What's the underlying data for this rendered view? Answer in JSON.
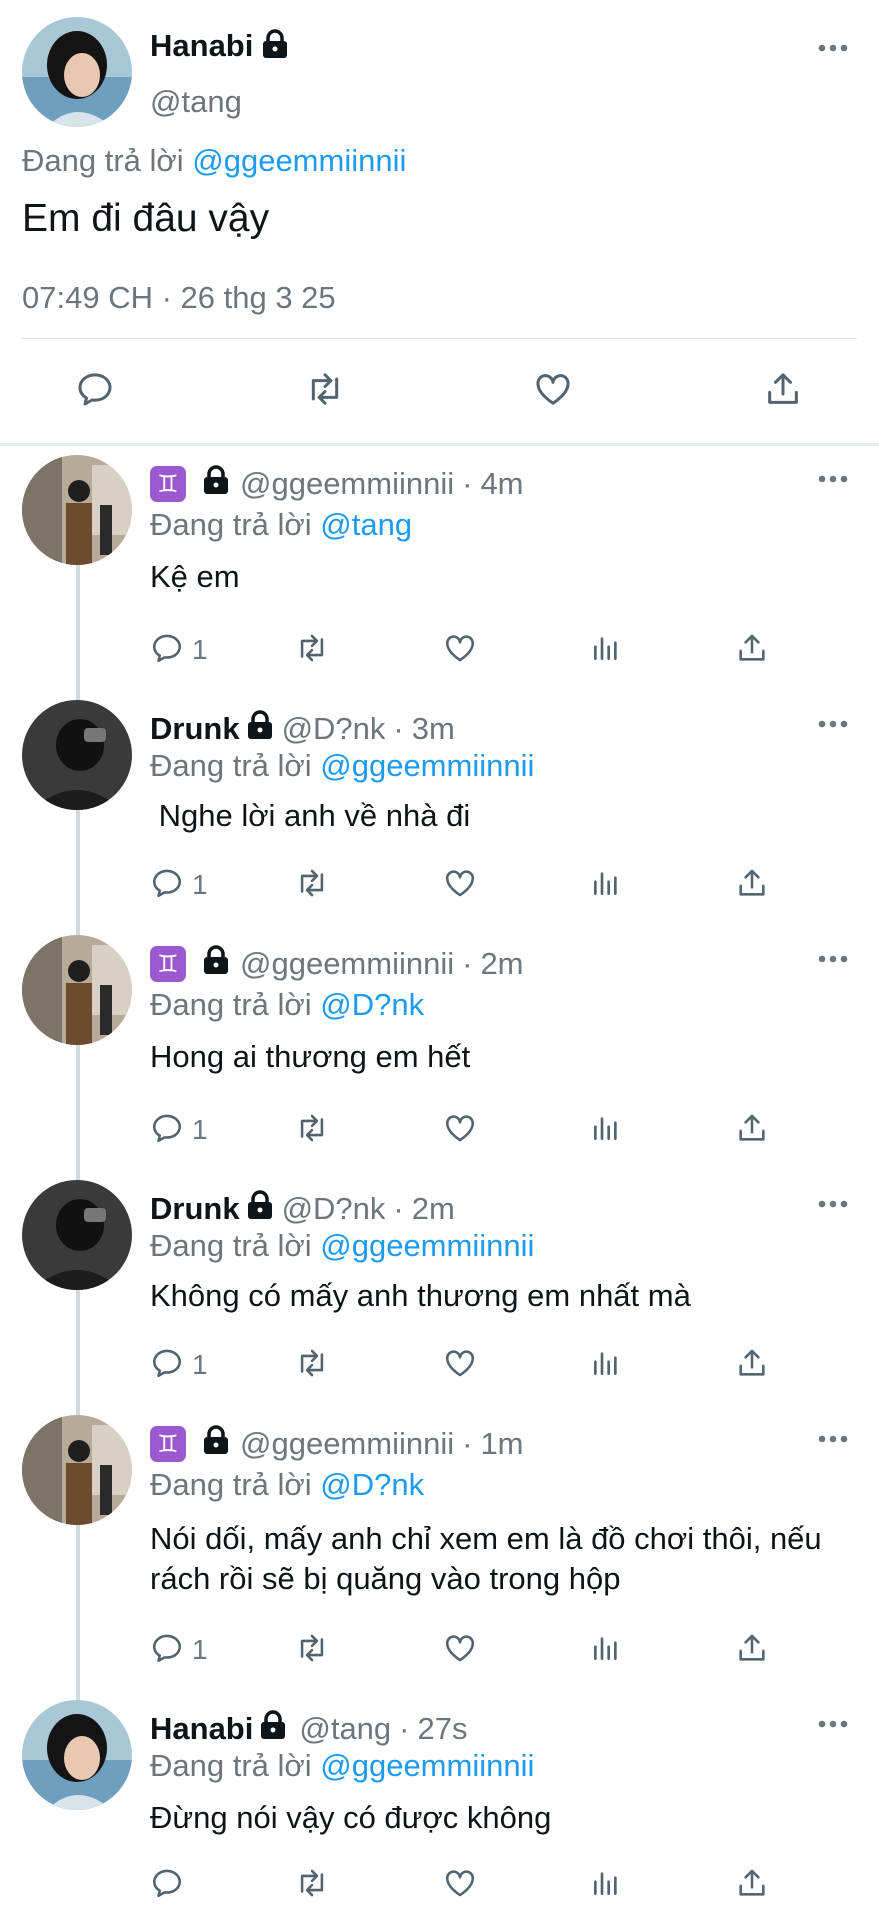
{
  "main_tweet": {
    "display_name": "Hanabi",
    "handle": "@tang",
    "replying_prefix": "Đang trả lời",
    "replying_to": "@ggeemmiinnii",
    "text": "Em đi đâu vậy",
    "timestamp": "07:49 CH · 26 thg 3 25",
    "actions": [
      "reply",
      "retweet",
      "like",
      "share"
    ]
  },
  "replies": [
    {
      "display_name": "",
      "badge": "♊",
      "protected": true,
      "handle": "@ggeemmiinnii",
      "time": "4m",
      "replying_prefix": "Đang trả lời",
      "replying_to": "@tang",
      "text": "Kệ em",
      "reply_count": "1"
    },
    {
      "display_name": "Drunk",
      "protected": true,
      "handle": "@D?nk",
      "time": "3m",
      "replying_prefix": "Đang trả lời",
      "replying_to": "@ggeemmiinnii",
      "text": " Nghe lời anh về nhà đi",
      "reply_count": "1"
    },
    {
      "display_name": "",
      "badge": "♊",
      "protected": true,
      "handle": "@ggeemmiinnii",
      "time": "2m",
      "replying_prefix": "Đang trả lời",
      "replying_to": "@D?nk",
      "text": "Hong ai thương em hết",
      "reply_count": "1"
    },
    {
      "display_name": "Drunk",
      "protected": true,
      "handle": "@D?nk",
      "time": "2m",
      "replying_prefix": "Đang trả lời",
      "replying_to": "@ggeemmiinnii",
      "text": "Không có mấy anh thương em nhất mà",
      "reply_count": "1"
    },
    {
      "display_name": "",
      "badge": "♊",
      "protected": true,
      "handle": "@ggeemmiinnii",
      "time": "1m",
      "replying_prefix": "Đang trả lời",
      "replying_to": "@D?nk",
      "text": "Nói dối, mấy anh chỉ xem em là đồ chơi thôi, nếu rách rồi sẽ bị quăng vào trong hộp",
      "reply_count": "1"
    },
    {
      "display_name": "Hanabi",
      "protected": true,
      "handle": "@tang",
      "time": "27s",
      "replying_prefix": "Đang trả lời",
      "replying_to": "@ggeemmiinnii",
      "text": "Đừng nói vậy có được không",
      "reply_count": ""
    }
  ],
  "separator": "·",
  "colors": {
    "link": "#1d9bf0",
    "secondary_text": "#6e767d",
    "primary_text": "#0f1419",
    "zodiac_badge": "#9b59d0",
    "thread_line": "#cfd9de"
  },
  "icons": {
    "reply": "reply-icon",
    "retweet": "retweet-icon",
    "like": "like-icon",
    "views": "views-icon",
    "share": "share-icon",
    "more": "more-icon",
    "lock": "lock-icon",
    "zodiac": "gemini-icon"
  }
}
